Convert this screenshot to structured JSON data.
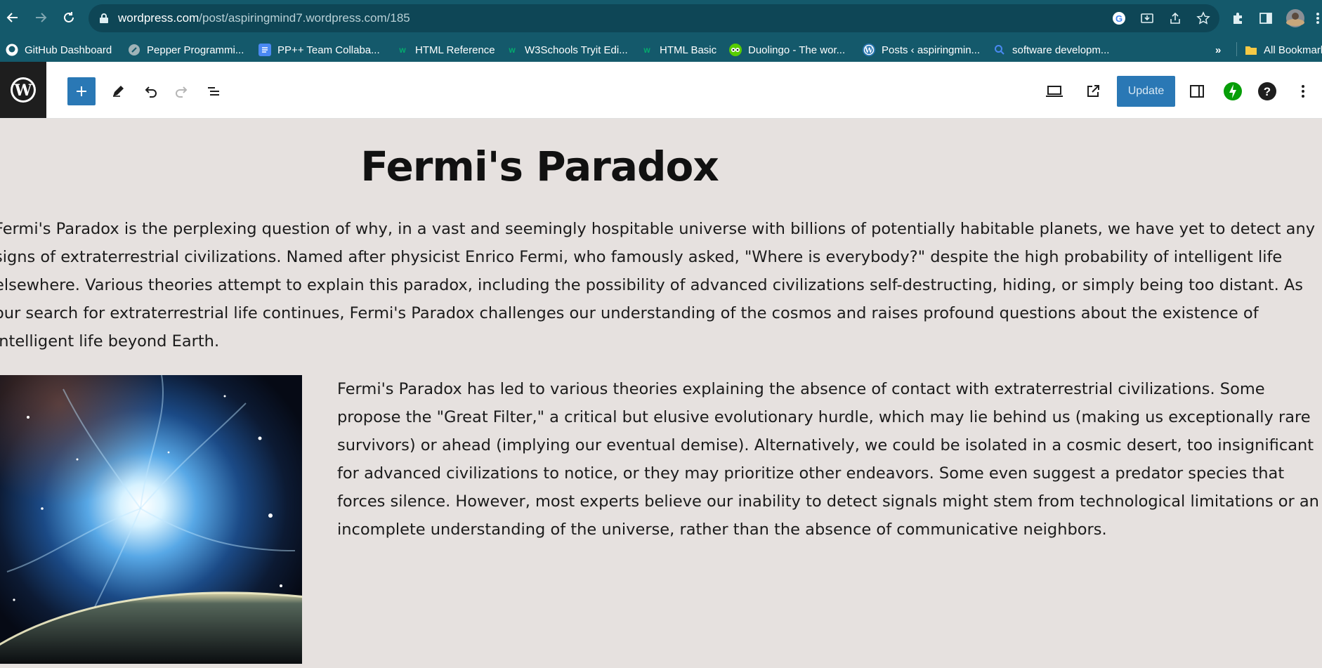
{
  "browser": {
    "url_host": "wordpress.com",
    "url_path": "/post/aspiringmind7.wordpress.com/185",
    "bookmarks": [
      {
        "label": "GitHub Dashboard",
        "icon": "github-icon"
      },
      {
        "label": "Pepper Programmi...",
        "icon": "pepper-icon"
      },
      {
        "label": "PP++ Team Collaba...",
        "icon": "docs-icon"
      },
      {
        "label": "HTML Reference",
        "icon": "w3-icon"
      },
      {
        "label": "W3Schools Tryit Edi...",
        "icon": "w3-icon"
      },
      {
        "label": "HTML Basic",
        "icon": "w3-icon"
      },
      {
        "label": "Duolingo - The wor...",
        "icon": "duolingo-icon"
      },
      {
        "label": "Posts ‹ aspiringmin...",
        "icon": "wordpress-icon"
      },
      {
        "label": "software developm...",
        "icon": "search-icon"
      }
    ],
    "overflow": "»",
    "all_bookmarks": "All Bookmarks"
  },
  "editor": {
    "update_label": "Update",
    "colors": {
      "accent": "#2a78b5",
      "jetpack": "#069e08",
      "chrome": "#14596b"
    }
  },
  "post": {
    "title": "Fermi's Paradox",
    "paragraph1": "Fermi's Paradox is the perplexing question of why, in a vast and seemingly hospitable universe with billions of potentially habitable planets, we have yet to detect any signs of extraterrestrial civilizations. Named after physicist Enrico Fermi, who famously asked, \"Where is everybody?\" despite the high probability of intelligent life elsewhere. Various theories attempt to explain this paradox, including the possibility of advanced civilizations self-destructing, hiding, or simply being too distant. As our search for extraterrestrial life continues, Fermi's Paradox challenges our understanding of the cosmos and raises profound questions about the existence of intelligent life beyond Earth.",
    "paragraph2": "Fermi's Paradox has led to various theories explaining the absence of contact with extraterrestrial civilizations. Some propose the \"Great Filter,\" a critical but elusive evolutionary hurdle, which may lie behind us (making us exceptionally rare survivors) or ahead (implying our eventual demise). Alternatively, we could be isolated in a cosmic desert, too insignificant for advanced civilizations to notice, or they may prioritize other endeavors. Some even suggest a predator species that forces silence. However, most experts believe our inability to detect signals might stem from technological limitations or an incomplete understanding of the universe, rather than the absence of communicative neighbors."
  }
}
